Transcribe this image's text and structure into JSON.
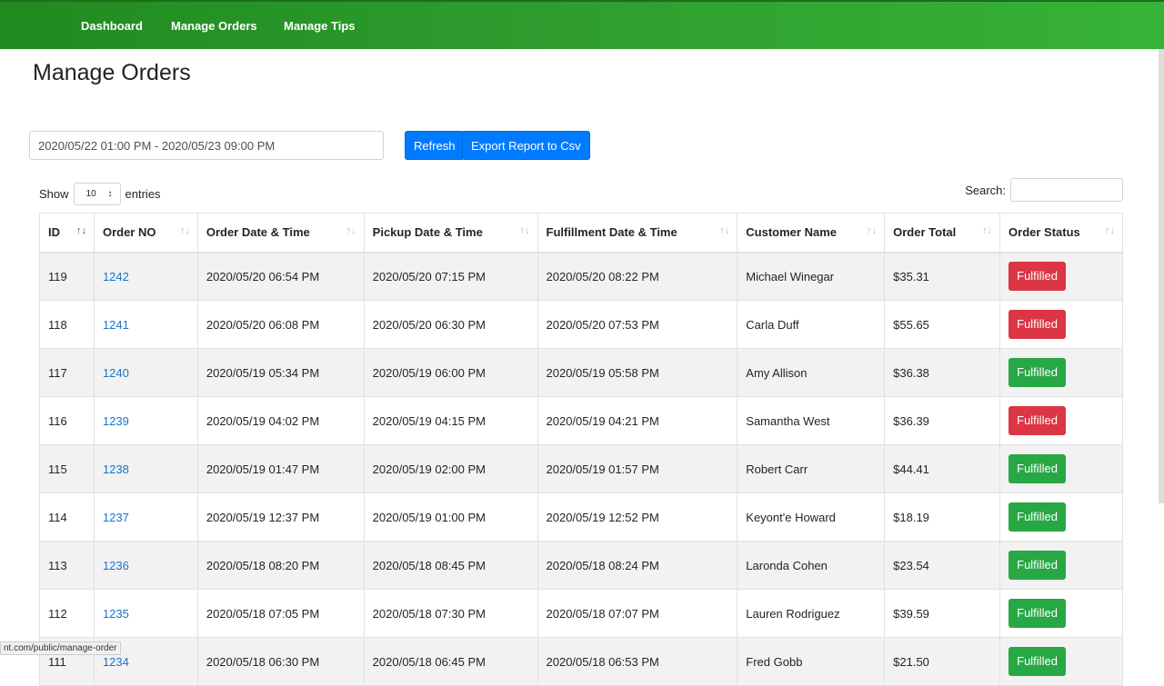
{
  "nav": {
    "items": [
      "Dashboard",
      "Manage Orders",
      "Manage Tips"
    ]
  },
  "page": {
    "title": "Manage Orders"
  },
  "filters": {
    "date_range": "2020/05/22 01:00 PM - 2020/05/23 09:00 PM",
    "refresh": "Refresh",
    "export": "Export Report to Csv"
  },
  "length": {
    "show": "Show",
    "value": "10",
    "entries": "entries"
  },
  "search": {
    "label": "Search:",
    "value": ""
  },
  "colors": {
    "nav": "#2f9e2f",
    "primary": "#007bff",
    "fulfilled_green": "#28a745",
    "fulfilled_red": "#dc3545"
  },
  "table": {
    "headers": [
      "ID",
      "Order NO",
      "Order Date & Time",
      "Pickup Date & Time",
      "Fulfillment Date & Time",
      "Customer Name",
      "Order Total",
      "Order Status"
    ],
    "rows": [
      {
        "id": "119",
        "no": "1242",
        "order": "2020/05/20 06:54 PM",
        "pickup": "2020/05/20 07:15 PM",
        "fulfill": "2020/05/20 08:22 PM",
        "customer": "Michael Winegar",
        "total": "$35.31",
        "status": "Fulfilled",
        "color": "red"
      },
      {
        "id": "118",
        "no": "1241",
        "order": "2020/05/20 06:08 PM",
        "pickup": "2020/05/20 06:30 PM",
        "fulfill": "2020/05/20 07:53 PM",
        "customer": "Carla Duff",
        "total": "$55.65",
        "status": "Fulfilled",
        "color": "red"
      },
      {
        "id": "117",
        "no": "1240",
        "order": "2020/05/19 05:34 PM",
        "pickup": "2020/05/19 06:00 PM",
        "fulfill": "2020/05/19 05:58 PM",
        "customer": "Amy Allison",
        "total": "$36.38",
        "status": "Fulfilled",
        "color": "green"
      },
      {
        "id": "116",
        "no": "1239",
        "order": "2020/05/19 04:02 PM",
        "pickup": "2020/05/19 04:15 PM",
        "fulfill": "2020/05/19 04:21 PM",
        "customer": "Samantha West",
        "total": "$36.39",
        "status": "Fulfilled",
        "color": "red"
      },
      {
        "id": "115",
        "no": "1238",
        "order": "2020/05/19 01:47 PM",
        "pickup": "2020/05/19 02:00 PM",
        "fulfill": "2020/05/19 01:57 PM",
        "customer": "Robert Carr",
        "total": "$44.41",
        "status": "Fulfilled",
        "color": "green"
      },
      {
        "id": "114",
        "no": "1237",
        "order": "2020/05/19 12:37 PM",
        "pickup": "2020/05/19 01:00 PM",
        "fulfill": "2020/05/19 12:52 PM",
        "customer": "Keyont'e Howard",
        "total": "$18.19",
        "status": "Fulfilled",
        "color": "green"
      },
      {
        "id": "113",
        "no": "1236",
        "order": "2020/05/18 08:20 PM",
        "pickup": "2020/05/18 08:45 PM",
        "fulfill": "2020/05/18 08:24 PM",
        "customer": "Laronda Cohen",
        "total": "$23.54",
        "status": "Fulfilled",
        "color": "green"
      },
      {
        "id": "112",
        "no": "1235",
        "order": "2020/05/18 07:05 PM",
        "pickup": "2020/05/18 07:30 PM",
        "fulfill": "2020/05/18 07:07 PM",
        "customer": "Lauren Rodriguez",
        "total": "$39.59",
        "status": "Fulfilled",
        "color": "green"
      },
      {
        "id": "111",
        "no": "1234",
        "order": "2020/05/18 06:30 PM",
        "pickup": "2020/05/18 06:45 PM",
        "fulfill": "2020/05/18 06:53 PM",
        "customer": "Fred Gobb",
        "total": "$21.50",
        "status": "Fulfilled",
        "color": "green"
      }
    ]
  },
  "statusbar": {
    "url": "nt.com/public/manage-order"
  }
}
